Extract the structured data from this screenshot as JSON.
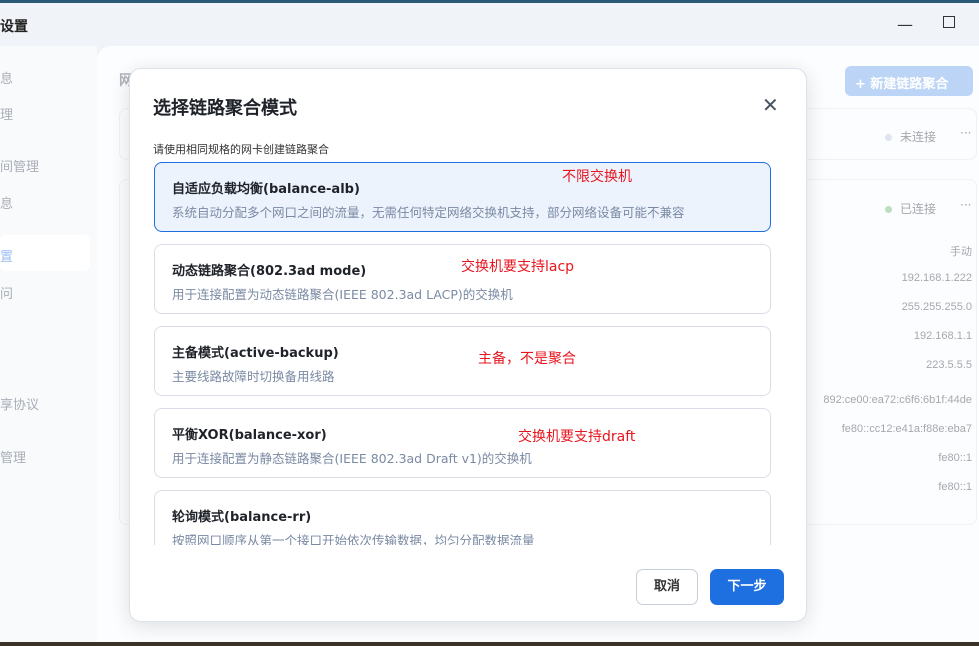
{
  "window": {
    "title": "设置",
    "minimize_icon": "minimize-icon",
    "maximize_icon": "maximize-icon"
  },
  "sidebar": {
    "items": [
      "息",
      "理",
      "间管理",
      "息",
      "置",
      "问",
      "享协议",
      "管理"
    ]
  },
  "main": {
    "title": "网",
    "new_button": "+  新建链路聚合",
    "rows": [
      {
        "status": "未连接",
        "status_color": "#dfe5ee",
        "more": "···"
      },
      {
        "status": "已连接",
        "status_color": "#b9dfc0",
        "more": "···",
        "values": [
          "手动",
          "192.168.1.222",
          "255.255.255.0",
          "192.168.1.1",
          "223.5.5.5"
        ],
        "ipv6": [
          "892:ce00:ea72:c6f6:6b1f:44de",
          "fe80::cc12:e41a:f88e:eba7",
          "fe80::1",
          "fe80::1"
        ]
      }
    ]
  },
  "dialog": {
    "title": "选择链路聚合模式",
    "close_icon": "close-icon",
    "subtitle": "请使用相同规格的网卡创建链路聚合",
    "options": [
      {
        "title": "自适应负载均衡(balance-alb)",
        "desc": "系统自动分配多个网口之间的流量，无需任何特定网络交换机支持，部分网络设备可能不兼容",
        "selected": true,
        "note": "不限交换机"
      },
      {
        "title": "动态链路聚合(802.3ad mode)",
        "desc": "用于连接配置为动态链路聚合(IEEE 802.3ad LACP)的交换机",
        "selected": false,
        "note": "交换机要支持lacp"
      },
      {
        "title": "主备模式(active-backup)",
        "desc": "主要线路故障时切换备用线路",
        "selected": false,
        "note": "主备，不是聚合"
      },
      {
        "title": "平衡XOR(balance-xor)",
        "desc": "用于连接配置为静态链路聚合(IEEE 802.3ad Draft v1)的交换机",
        "selected": false,
        "note": "交换机要支持draft"
      },
      {
        "title": "轮询模式(balance-rr)",
        "desc": "按照网口顺序从第一个接口开始依次传输数据，均匀分配数据流量",
        "selected": false
      }
    ],
    "cancel": "取消",
    "next": "下一步",
    "accent": "#1e6fe0"
  }
}
